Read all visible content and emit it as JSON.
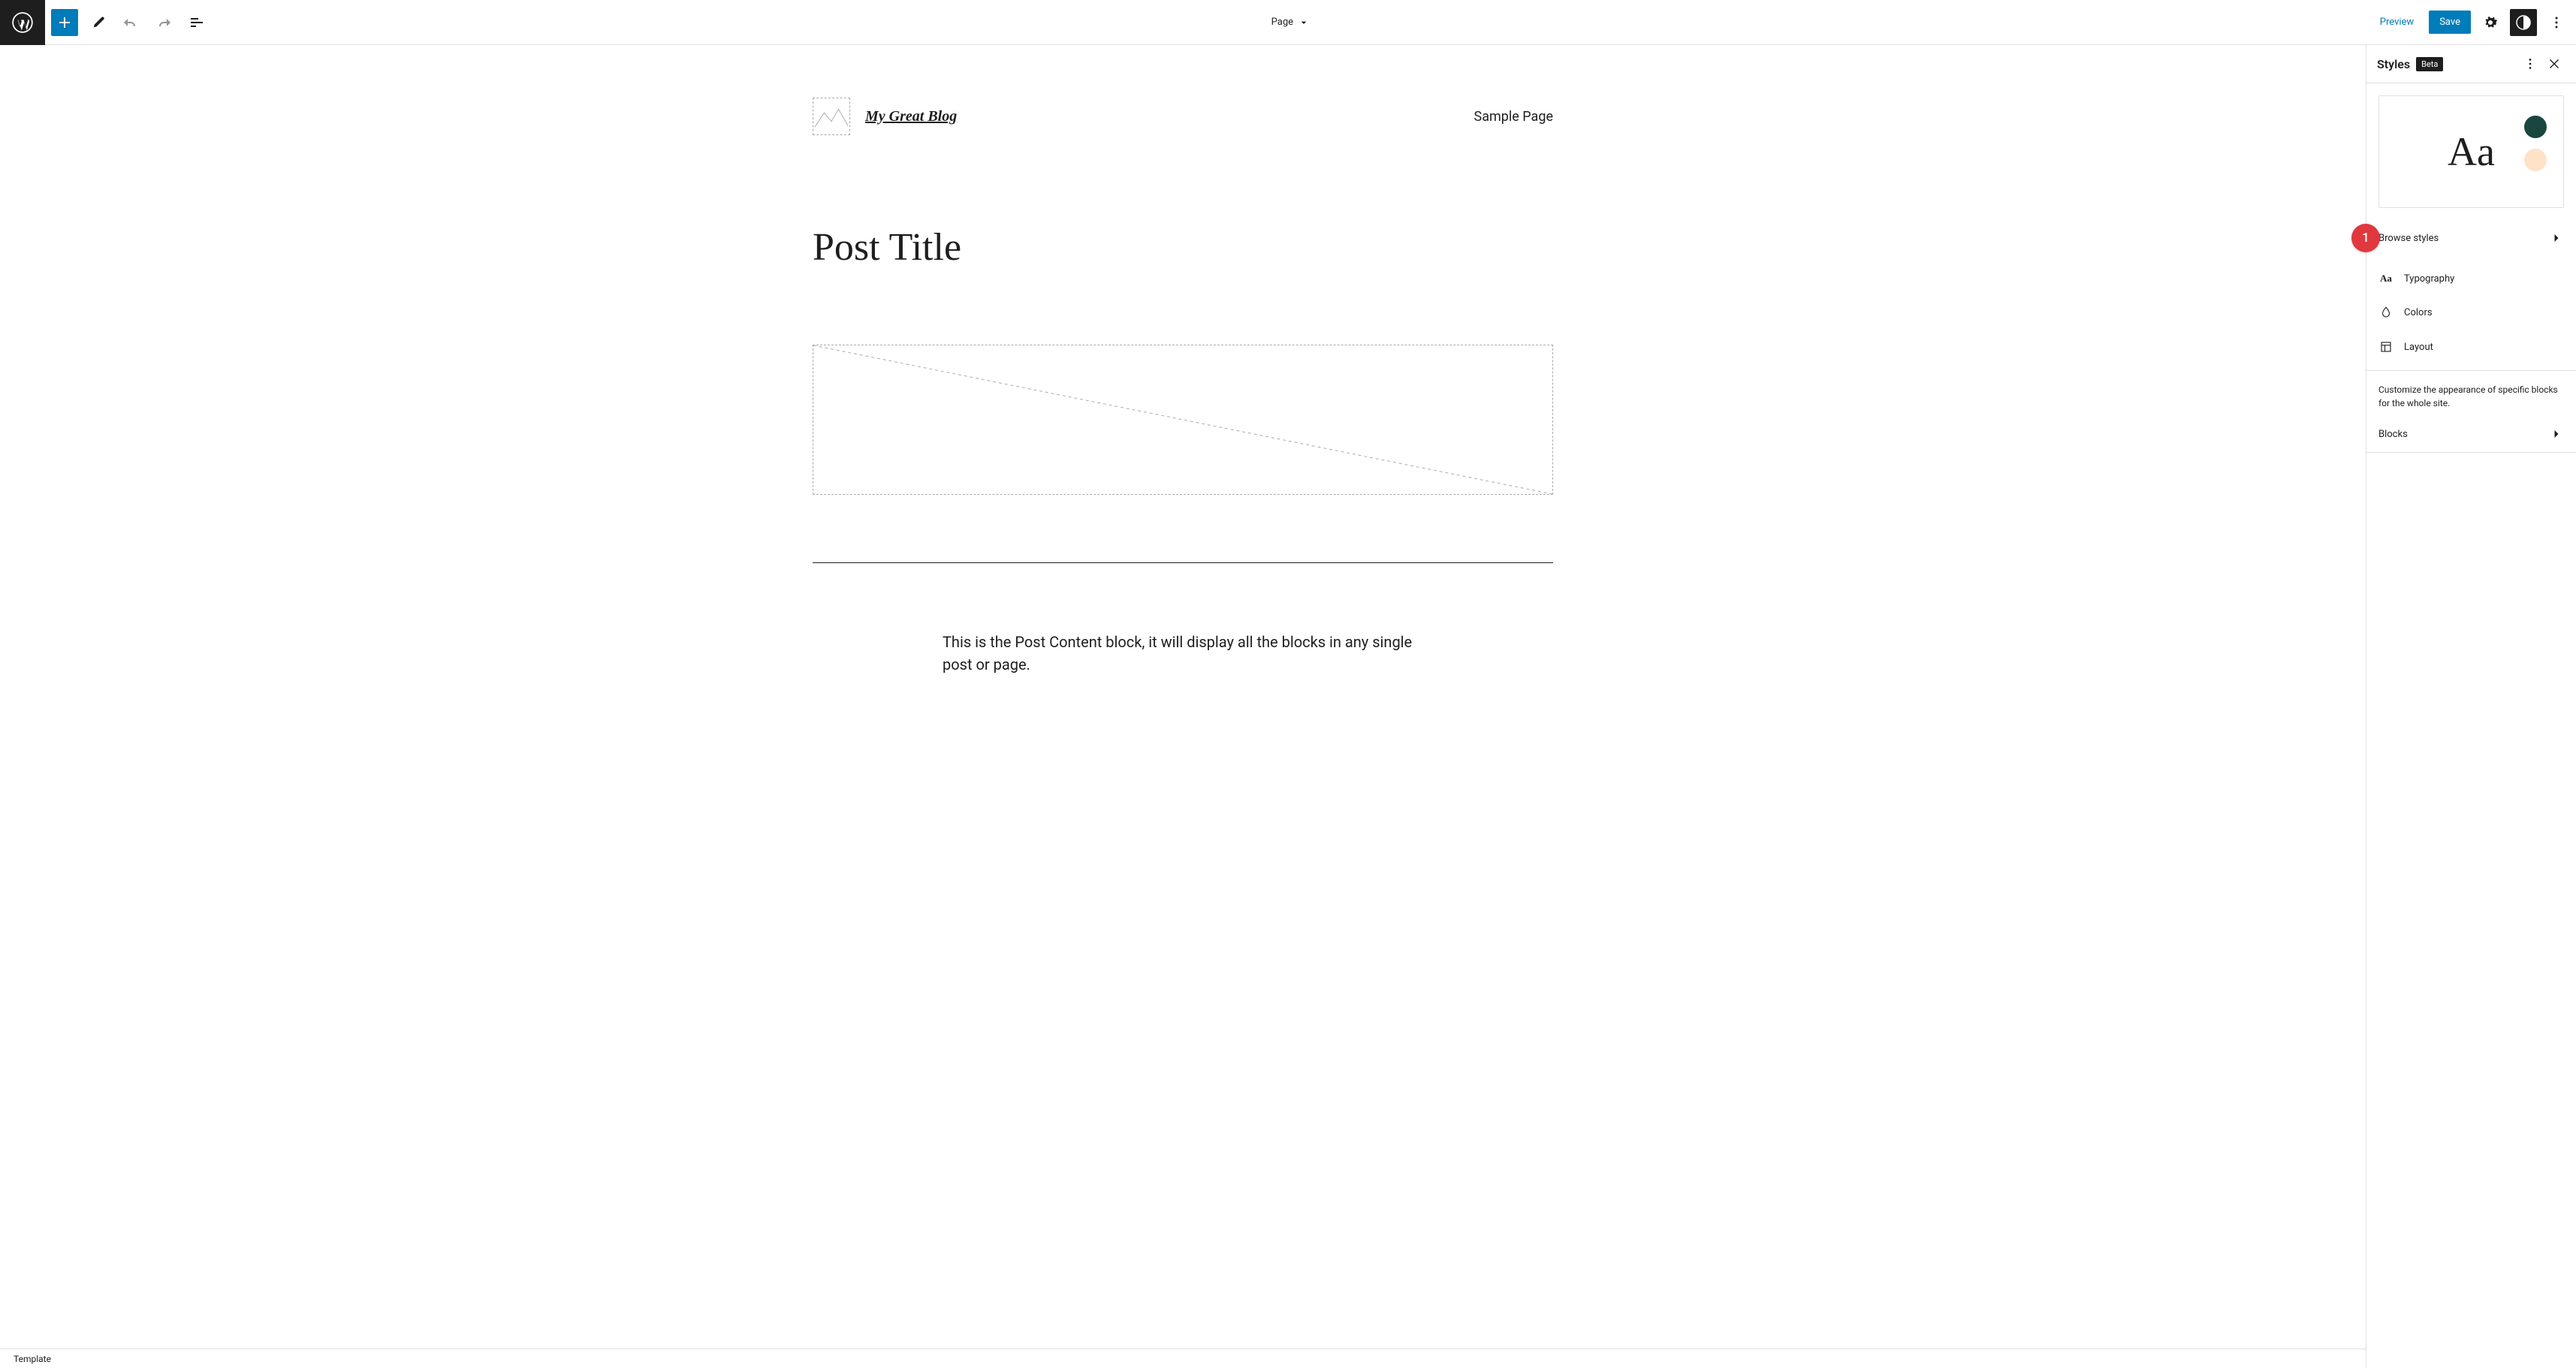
{
  "toolbar": {
    "document_type": "Page",
    "preview_label": "Preview",
    "save_label": "Save"
  },
  "canvas": {
    "site_title": "My Great Blog",
    "nav": {
      "items": [
        "Sample Page"
      ]
    },
    "post_title": "Post Title",
    "post_content_text": "This is the Post Content block, it will display all the blocks in any single post or page."
  },
  "footer": {
    "breadcrumb": "Template"
  },
  "sidebar": {
    "title": "Styles",
    "badge": "Beta",
    "preview": {
      "sample": "Aa",
      "swatch_primary": "#1a4640",
      "swatch_secondary": "#ffe2c7"
    },
    "browse_styles": "Browse styles",
    "items": [
      {
        "icon": "aa",
        "label": "Typography"
      },
      {
        "icon": "drop",
        "label": "Colors"
      },
      {
        "icon": "layout",
        "label": "Layout"
      }
    ],
    "blocks_desc": "Customize the appearance of specific blocks for the whole site.",
    "blocks_label": "Blocks"
  },
  "annotations": {
    "browse_styles_badge": "1"
  }
}
